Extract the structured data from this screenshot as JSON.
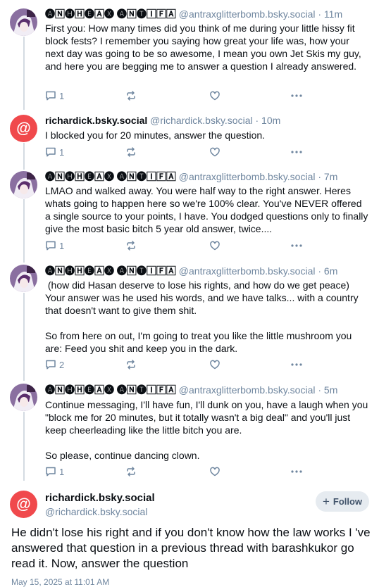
{
  "thread": [
    {
      "author_name": "🅐🄽🅗🄷🅔🄰🅧 🅐🄽🅣🄸🄵🄰",
      "handle": "@antraxglitterbomb.bsky.social · 11m",
      "avatar": "purple-anime-avatar",
      "text": "First you: How many times did you think of me during your little hissy fit block fests? I remember you saying how great your life was, how your next day was going to be so awesome, I mean you own Jet Skis my guy, and here you are begging me to answer a question I already answered.",
      "reply_count": "1",
      "repost_count": "",
      "like_count": ""
    },
    {
      "author_name": "richardick.bsky.social",
      "handle": "@richardick.bsky.social · 10m",
      "avatar": "red-at-avatar",
      "text": "I blocked you for 20 minutes, answer the question.",
      "reply_count": "1",
      "repost_count": "",
      "like_count": ""
    },
    {
      "author_name": "🅐🄽🅗🄷🅔🄰🅧 🅐🄽🅣🄸🄵🄰",
      "handle": "@antraxglitterbomb.bsky.social · 7m",
      "avatar": "purple-anime-avatar",
      "text": "LMAO and walked away. You were half way to the right answer. Heres whats going to happen here so we're 100% clear. You've NEVER offered a single source to your points, I have. You dodged questions only to finally give the most basic bitch 5 year old answer, twice....",
      "reply_count": "1",
      "repost_count": "",
      "like_count": ""
    },
    {
      "author_name": "🅐🄽🅗🄷🅔🄰🅧 🅐🄽🅣🄸🄵🄰",
      "handle": "@antraxglitterbomb.bsky.social · 6m",
      "avatar": "purple-anime-avatar",
      "text": " (how did Hasan deserve to lose his rights, and how do we get peace)\nYour answer was he used his words, and we have talks... with a country that doesn't want to give them shit.\n\nSo from here on out, I'm going to treat you like the little mushroom you are: Feed you shit and keep you in the dark.",
      "reply_count": "2",
      "repost_count": "",
      "like_count": ""
    },
    {
      "author_name": "🅐🄽🅗🄷🅔🄰🅧 🅐🄽🅣🄸🄵🄰",
      "handle": "@antraxglitterbomb.bsky.social · 5m",
      "avatar": "purple-anime-avatar",
      "text": "Continue messaging, I'll have fun, I'll dunk on you, have a laugh when you \"block me for 20 minutes, but it totally wasn't a big deal\" and you'll just keep cheerleading like the little bitch you are.\n\nSo please, continue dancing clown.",
      "reply_count": "1",
      "repost_count": "",
      "like_count": ""
    }
  ],
  "main_post": {
    "author_name": "richardick.bsky.social",
    "handle": "@richardick.bsky.social",
    "follow_label": "Follow",
    "text": "He didn't lose his right and if you don't know how the law works I 've answered that question in a previous thread with barashkukor go read it. Now, answer the question",
    "date": "May 15, 2025 at 11:01 AM"
  },
  "colors": {
    "accent_red": "#f0494c",
    "muted_text": "#6f869f",
    "thread_line": "#d4dbe2",
    "follow_bg": "#e6ebf0"
  }
}
